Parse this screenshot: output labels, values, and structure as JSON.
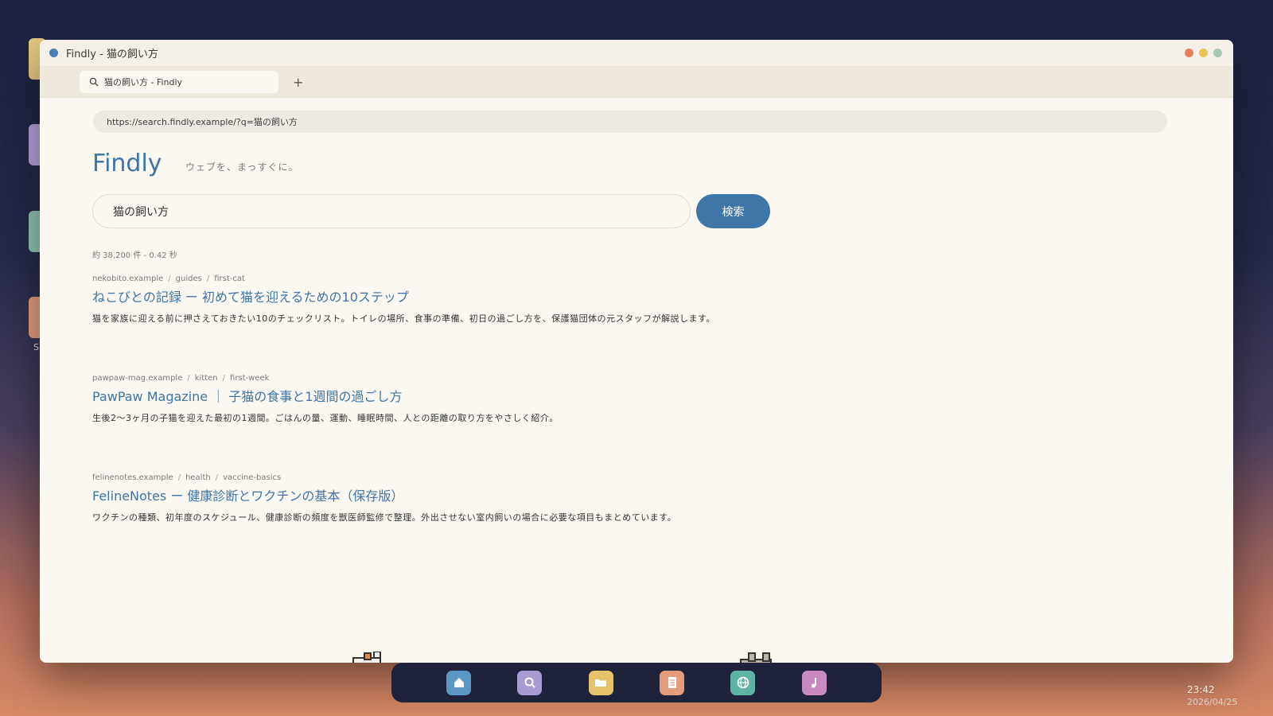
{
  "desktop": {
    "partial_label": "S",
    "icon_colors": [
      "#e9c983",
      "#b9a3dc",
      "#8fc8b6",
      "#e7a07f"
    ]
  },
  "window": {
    "title": "Findly - 猫の飼い方",
    "traffic_colors": [
      "#e77f5f",
      "#e9c45b",
      "#a8c7b5"
    ]
  },
  "tab": {
    "label": "猫の飼い方 - Findly",
    "new_tab_label": "+"
  },
  "address": {
    "url": "https://search.findly.example/?q=猫の飼い方"
  },
  "brand": {
    "logo": "Findly",
    "tagline": "ウェブを、まっすぐに。",
    "accent": "#3f76a8"
  },
  "search": {
    "query": "猫の飼い方",
    "button_label": "検索",
    "stats": "約 38,200 件 - 0.42 秒"
  },
  "results": [
    {
      "crumbs": [
        "nekobito.example",
        "guides",
        "first-cat"
      ],
      "title": "ねこびとの記録 ー 初めて猫を迎えるための10ステップ",
      "desc": "猫を家族に迎える前に押さえておきたい10のチェックリスト。トイレの場所、食事の準備、初日の過ごし方を、保護猫団体の元スタッフが解説します。"
    },
    {
      "crumbs": [
        "pawpaw-mag.example",
        "kitten",
        "first-week"
      ],
      "title": "PawPaw Magazine ｜ 子猫の食事と1週間の過ごし方",
      "desc": "生後2〜3ヶ月の子猫を迎えた最初の1週間。ごはんの量、運動、睡眠時間、人との距離の取り方をやさしく紹介。"
    },
    {
      "crumbs": [
        "felinenotes.example",
        "health",
        "vaccine-basics"
      ],
      "title": "FelineNotes ー 健康診断とワクチンの基本（保存版）",
      "desc": "ワクチンの種類、初年度のスケジュール、健康診断の頻度を獣医師監修で整理。外出させない室内飼いの場合に必要な項目もまとめています。"
    }
  ],
  "dock": {
    "icons": [
      {
        "name": "home-icon",
        "color": "#5b97c4"
      },
      {
        "name": "search-icon",
        "color": "#a79bd2"
      },
      {
        "name": "folder-icon",
        "color": "#e6c26a"
      },
      {
        "name": "document-icon",
        "color": "#e49c7a"
      },
      {
        "name": "globe-icon",
        "color": "#5fb3a3"
      },
      {
        "name": "music-icon",
        "color": "#c98ac0"
      }
    ]
  },
  "clock": {
    "time": "23:42",
    "date": "2026/04/25"
  }
}
